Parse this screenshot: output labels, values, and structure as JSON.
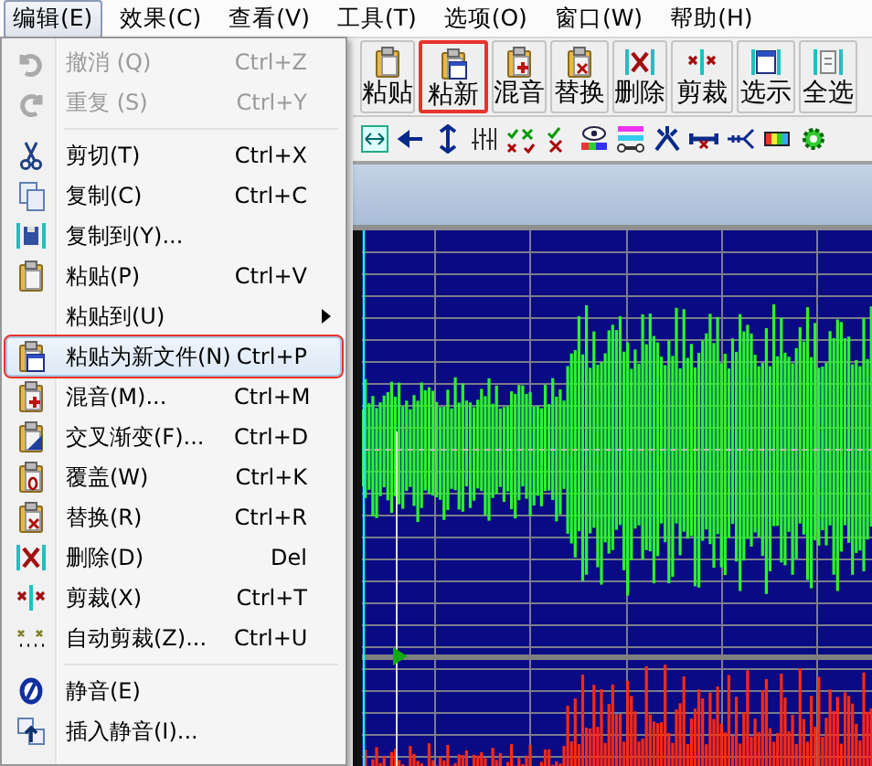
{
  "menubar": [
    {
      "label": "编辑(E)",
      "selected": true
    },
    {
      "label": "效果(C)",
      "selected": false
    },
    {
      "label": "查看(V)",
      "selected": false
    },
    {
      "label": "工具(T)",
      "selected": false
    },
    {
      "label": "选项(O)",
      "selected": false
    },
    {
      "label": "窗口(W)",
      "selected": false
    },
    {
      "label": "帮助(H)",
      "selected": false
    }
  ],
  "toolbar": [
    {
      "label": "粘贴",
      "marked": false
    },
    {
      "label": "粘新",
      "marked": true
    },
    {
      "label": "混音",
      "marked": false
    },
    {
      "label": "替换",
      "marked": false
    },
    {
      "label": "删除",
      "marked": false
    },
    {
      "label": "剪裁",
      "marked": false
    },
    {
      "label": "选示",
      "marked": false
    },
    {
      "label": "全选",
      "marked": false
    }
  ],
  "edit_menu": [
    {
      "kind": "item",
      "label": "撤消 (Q)",
      "shortcut": "Ctrl+Z",
      "disabled": true,
      "highlighted": false,
      "marked": false
    },
    {
      "kind": "item",
      "label": "重复 (S)",
      "shortcut": "Ctrl+Y",
      "disabled": true,
      "highlighted": false,
      "marked": false
    },
    {
      "kind": "separator"
    },
    {
      "kind": "item",
      "label": "剪切(T)",
      "shortcut": "Ctrl+X",
      "disabled": false,
      "highlighted": false,
      "marked": false
    },
    {
      "kind": "item",
      "label": "复制(C)",
      "shortcut": "Ctrl+C",
      "disabled": false,
      "highlighted": false,
      "marked": false
    },
    {
      "kind": "item",
      "label": "复制到(Y)...",
      "disabled": false,
      "highlighted": false,
      "marked": false
    },
    {
      "kind": "item",
      "label": "粘贴(P)",
      "shortcut": "Ctrl+V",
      "disabled": false,
      "highlighted": false,
      "marked": false
    },
    {
      "kind": "submenu",
      "label": "粘贴到(U)",
      "disabled": false,
      "highlighted": false,
      "marked": false
    },
    {
      "kind": "item",
      "label": "粘贴为新文件(N)",
      "shortcut": "Ctrl+P",
      "disabled": false,
      "highlighted": true,
      "marked": true
    },
    {
      "kind": "item",
      "label": "混音(M)...",
      "shortcut": "Ctrl+M",
      "disabled": false,
      "highlighted": false,
      "marked": false
    },
    {
      "kind": "item",
      "label": "交叉渐变(F)...",
      "shortcut": "Ctrl+D",
      "disabled": false,
      "highlighted": false,
      "marked": false
    },
    {
      "kind": "item",
      "label": "覆盖(W)",
      "shortcut": "Ctrl+K",
      "disabled": false,
      "highlighted": false,
      "marked": false
    },
    {
      "kind": "item",
      "label": "替换(R)",
      "shortcut": "Ctrl+R",
      "disabled": false,
      "highlighted": false,
      "marked": false
    },
    {
      "kind": "item",
      "label": "删除(D)",
      "shortcut": "Del",
      "disabled": false,
      "highlighted": false,
      "marked": false
    },
    {
      "kind": "item",
      "label": "剪裁(X)",
      "shortcut": "Ctrl+T",
      "disabled": false,
      "highlighted": false,
      "marked": false
    },
    {
      "kind": "item",
      "label": "自动剪裁(Z)...",
      "shortcut": "Ctrl+U",
      "disabled": false,
      "highlighted": false,
      "marked": false
    },
    {
      "kind": "separator"
    },
    {
      "kind": "item",
      "label": "静音(E)",
      "disabled": false,
      "highlighted": false,
      "marked": false
    },
    {
      "kind": "item",
      "label": "插入静音(I)...",
      "disabled": false,
      "highlighted": false,
      "marked": false
    }
  ]
}
